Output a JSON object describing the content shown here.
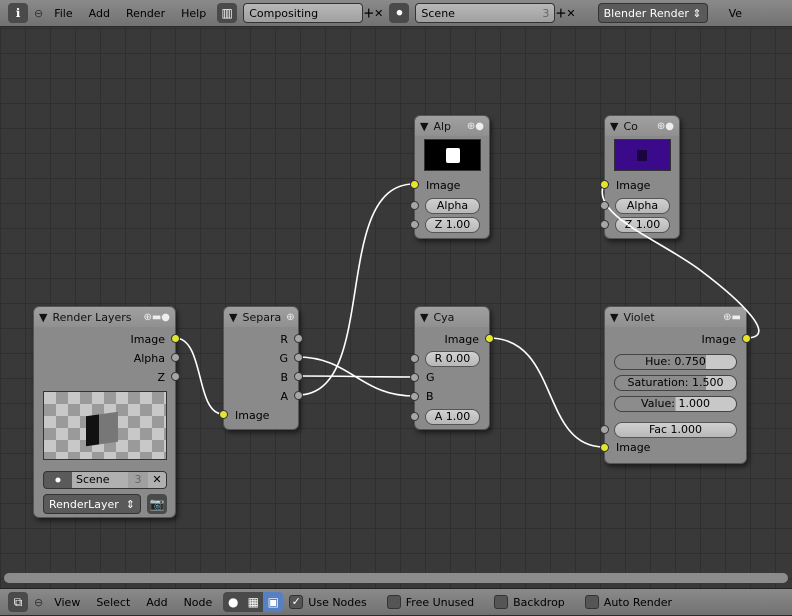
{
  "topbar": {
    "menus": [
      "File",
      "Add",
      "Render",
      "Help"
    ],
    "layout": "Compositing",
    "scene": "Scene",
    "scene_users": "3",
    "engine": "Blender Render",
    "trailing": "Ve"
  },
  "bottombar": {
    "menus": [
      "View",
      "Select",
      "Add",
      "Node"
    ],
    "checkboxes": [
      {
        "label": "Use Nodes",
        "checked": true
      },
      {
        "label": "Free Unused",
        "checked": false
      },
      {
        "label": "Backdrop",
        "checked": false
      },
      {
        "label": "Auto Render",
        "checked": false
      }
    ]
  },
  "nodes": {
    "render_layers": {
      "title": "Render Layers",
      "outputs": [
        "Image",
        "Alpha",
        "Z"
      ],
      "scene": "Scene",
      "scene_users": "3",
      "layer": "RenderLayer"
    },
    "separate": {
      "title": "Separa",
      "outputs": [
        "R",
        "G",
        "B",
        "A"
      ],
      "input": "Image"
    },
    "alpha": {
      "title": "Alp",
      "input": "Image",
      "alpha": "Alpha",
      "z": "Z 1.00"
    },
    "composite": {
      "title": "Co",
      "input": "Image",
      "alpha": "Alpha",
      "z": "Z 1.00"
    },
    "combine": {
      "title": "Cya",
      "output": "Image",
      "inputs": [
        "R 0.00",
        "G",
        "B",
        "A 1.00"
      ]
    },
    "hsv": {
      "title": "Violet",
      "output": "Image",
      "hue": "Hue: 0.750",
      "hue_value": 0.75,
      "saturation": "Saturation: 1.500",
      "saturation_value": 0.75,
      "value": "Value: 1.000",
      "value_value": 0.5,
      "fac": "Fac 1.000",
      "input": "Image"
    }
  },
  "colors": {
    "socket_color": "#e5e52e",
    "link": "#ffffff",
    "preview_purple": "#3a0a8a"
  }
}
